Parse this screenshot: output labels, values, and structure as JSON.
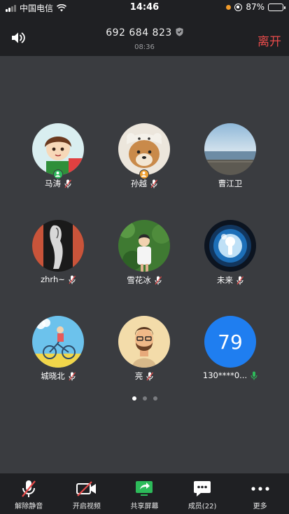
{
  "status_bar": {
    "carrier": "中国电信",
    "time": "14:46",
    "battery": "87%",
    "battery_level": 0.87
  },
  "header": {
    "meeting_id": "692 684 823",
    "duration": "08:36",
    "leave_label": "离开"
  },
  "participants": [
    {
      "name": "马涛",
      "muted": true,
      "host_badge": true,
      "badge_color": "#2dbb5a"
    },
    {
      "name": "孙越",
      "muted": true,
      "host_badge": true,
      "badge_color": "#f0a030"
    },
    {
      "name": "曹江卫",
      "muted": false,
      "host_badge": false
    },
    {
      "name": "zhrh~",
      "muted": true,
      "host_badge": false
    },
    {
      "name": "雪花冰",
      "muted": true,
      "host_badge": false
    },
    {
      "name": "未来",
      "muted": true,
      "host_badge": false
    },
    {
      "name": "城晓北",
      "muted": true,
      "host_badge": false
    },
    {
      "name": "亮",
      "muted": true,
      "host_badge": false
    },
    {
      "name": "130****0...",
      "muted": false,
      "speaking": true,
      "avatar_text": "79"
    }
  ],
  "pager": {
    "pages": 3,
    "active": 0
  },
  "toolbar": {
    "unmute_label": "解除静音",
    "video_label": "开启视频",
    "share_label": "共享屏幕",
    "members_label": "成员(22)",
    "more_label": "更多"
  },
  "colors": {
    "background": "#3a3c40",
    "bar": "#1f2023",
    "leave": "#e84b4b",
    "share_green": "#2dbb5a",
    "number_avatar": "#1f7ef0"
  }
}
